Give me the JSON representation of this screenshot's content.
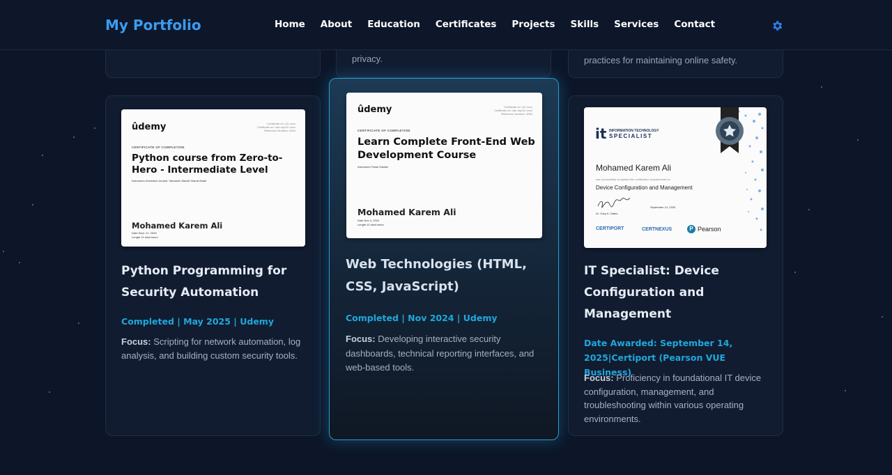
{
  "nav": {
    "brand": "My Portfolio",
    "links": [
      "Home",
      "About",
      "Education",
      "Certificates",
      "Projects",
      "Skills",
      "Services",
      "Contact"
    ]
  },
  "top_cards": [
    {
      "text": ""
    },
    {
      "text": "privacy."
    },
    {
      "text": "practices for maintaining online safety."
    }
  ],
  "cards": [
    {
      "title": "Python Programming for Security Automation",
      "meta": "Completed | May 2025 | Udemy",
      "focus_label": "Focus:",
      "focus_text": " Scripting for network automation, log analysis, and building custom security tools.",
      "cert": {
        "logo": "ûdemy",
        "label": "CERTIFICATE OF COMPLETION",
        "course": "Python course from Zero-to-Hero - Intermediate Level",
        "instructors": "Instructors  Khomaira Jonaed,  Samaneh Mazidi Sharaf Abadi",
        "name": "Mohamed Karem Ali",
        "date": "Date  Sept. 21, 2025",
        "length": "Length  21 total hours"
      }
    },
    {
      "title": "Web Technologies (HTML, CSS, JavaScript)",
      "meta": "Completed | Nov 2024 | Udemy",
      "focus_label": "Focus:",
      "focus_text": " Developing interactive security dashboards, technical reporting interfaces, and web-based tools.",
      "cert": {
        "logo": "ûdemy",
        "label": "CERTIFICATE OF COMPLETION",
        "course": "Learn Complete Front-End Web Development Course",
        "instructors": "Instructors  Fatah Galalai",
        "name": "Mohamed Karem Ali",
        "date": "Date  Nov 4, 2024",
        "length": "Length  41 total hours"
      }
    },
    {
      "title": "IT Specialist: Device Configuration and Management",
      "meta": "Date Awarded: September 14, 2025|Certiport (Pearson VUE Business)",
      "focus_label": "Focus:",
      "focus_text": " Proficiency in foundational IT device configuration, management, and troubleshooting within various operating environments.",
      "cert": {
        "logo_top": "INFORMATION TECHNOLOGY",
        "logo_bottom": "SPECIALIST",
        "name": "Mohamed Karem Ali",
        "achieve": "has successfully completed the certification requirements for",
        "course": "Device Configuration and Management",
        "date": "September 14, 2025",
        "signer": "Dr. Gary A. Gates",
        "brands": [
          "CERTIPORT",
          "CERTNEXUS",
          "Pearson"
        ]
      }
    }
  ],
  "colors": {
    "background": "#0c1628",
    "accent": "#1fa8dc",
    "brand": "#3b9cf0",
    "card_border_featured": "#2a9ad0"
  },
  "icons": {
    "theme_toggle": "gear-icon"
  }
}
